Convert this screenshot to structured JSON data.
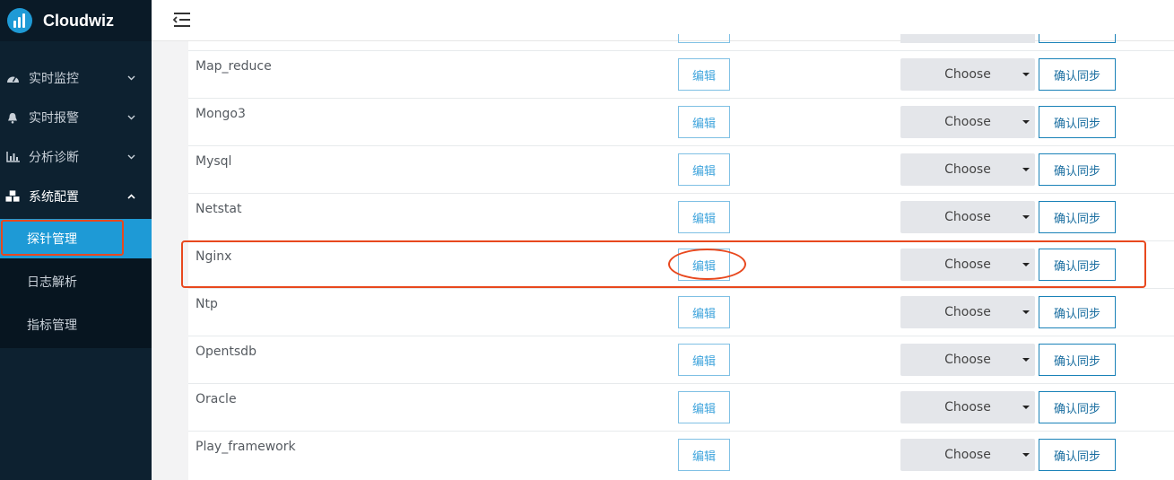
{
  "brand": {
    "name": "Cloudwiz"
  },
  "sidebar": {
    "items": [
      {
        "label": "实时监控",
        "icon": "dashboard-icon"
      },
      {
        "label": "实时报警",
        "icon": "bell-icon"
      },
      {
        "label": "分析诊断",
        "icon": "bar-chart-icon"
      },
      {
        "label": "系统配置",
        "icon": "cubes-icon"
      }
    ],
    "sub_items": [
      {
        "label": "探针管理",
        "active": true
      },
      {
        "label": "日志解析"
      },
      {
        "label": "指标管理"
      }
    ]
  },
  "table": {
    "edit_label": "编辑",
    "select_label": "Choose",
    "sync_label": "确认同步",
    "rows": [
      {
        "name": "Map_reduce"
      },
      {
        "name": "Mongo3"
      },
      {
        "name": "Mysql"
      },
      {
        "name": "Netstat"
      },
      {
        "name": "Nginx"
      },
      {
        "name": "Ntp"
      },
      {
        "name": "Opentsdb"
      },
      {
        "name": "Oracle"
      },
      {
        "name": "Play_framework"
      }
    ]
  },
  "colors": {
    "accent": "#1e9ad6",
    "sidebar_bg": "#0d2130",
    "highlight": "#e8481e"
  }
}
